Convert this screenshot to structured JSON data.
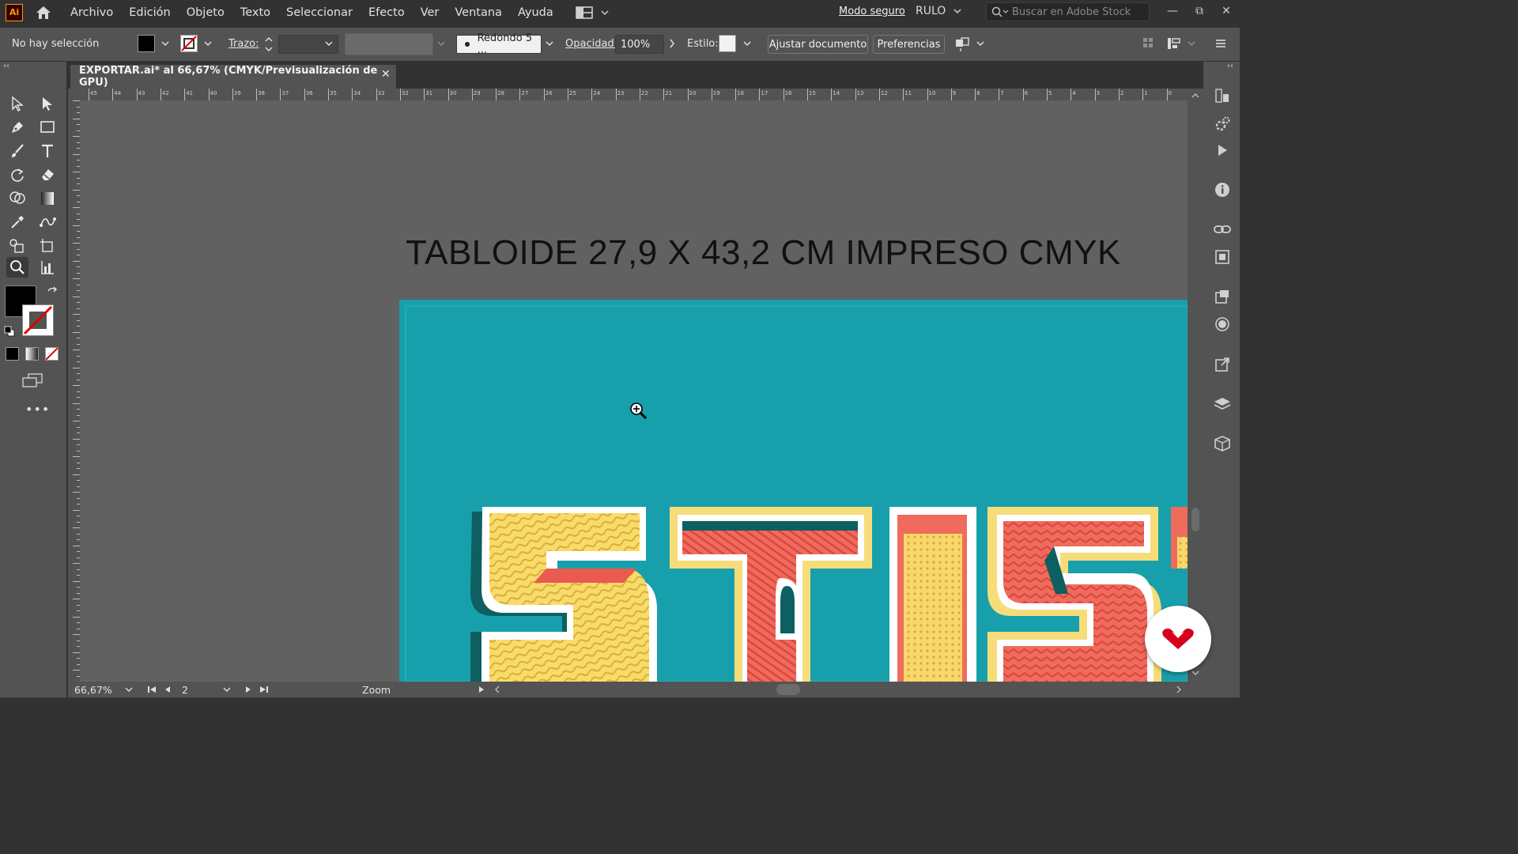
{
  "app": {
    "logo": "Ai"
  },
  "menu": {
    "items": [
      "Archivo",
      "Edición",
      "Objeto",
      "Texto",
      "Seleccionar",
      "Efecto",
      "Ver",
      "Ventana",
      "Ayuda"
    ]
  },
  "header": {
    "mode": "Modo seguro",
    "workspace": "RULO",
    "search_placeholder": "Buscar en Adobe Stock"
  },
  "control": {
    "selection": "No hay selección",
    "stroke_label": "Trazo:",
    "brush": "Redondo 5 ...",
    "opacity_label": "Opacidad:",
    "opacity_value": "100%",
    "style_label": "Estilo:",
    "adjust_button": "Ajustar documento",
    "prefs_button": "Preferencias"
  },
  "document": {
    "tab_title": "EXPORTAR.ai* al 66,67% (CMYK/Previsualización de GPU)",
    "headline": "TABLOIDE  27,9 X 43,2 CM   IMPRESO  CMYK",
    "artboard_color": "#17a0ab"
  },
  "ruler": {
    "h_labels": [
      "45",
      "44",
      "43",
      "42",
      "41",
      "40",
      "39",
      "38",
      "37",
      "36",
      "35",
      "34",
      "33",
      "32",
      "31",
      "30",
      "29",
      "28",
      "27",
      "26",
      "25",
      "24",
      "23",
      "22",
      "21",
      "20",
      "19",
      "18",
      "17",
      "16",
      "15",
      "14",
      "13",
      "12",
      "11",
      "10",
      "9",
      "8",
      "7",
      "6",
      "5",
      "4",
      "3",
      "2",
      "1",
      "0"
    ]
  },
  "status": {
    "zoom": "66,67%",
    "page": "2",
    "tool": "Zoom"
  },
  "colors": {
    "accent": "#ff9a00",
    "fab": "#d6001c"
  }
}
